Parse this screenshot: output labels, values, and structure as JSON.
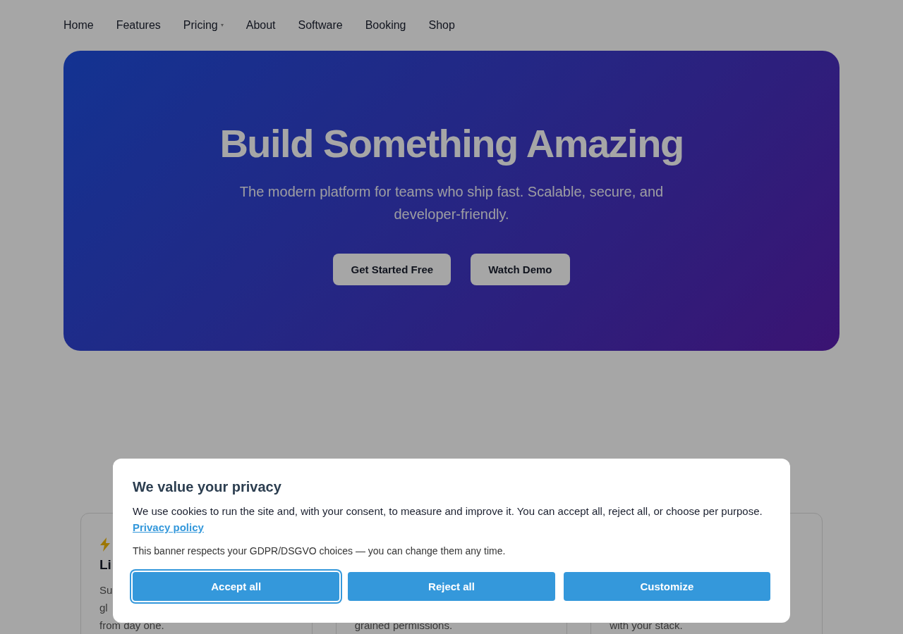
{
  "nav": [
    {
      "label": "Home",
      "has_dropdown": false
    },
    {
      "label": "Features",
      "has_dropdown": false
    },
    {
      "label": "Pricing",
      "has_dropdown": true
    },
    {
      "label": "About",
      "has_dropdown": false
    },
    {
      "label": "Software",
      "has_dropdown": false
    },
    {
      "label": "Booking",
      "has_dropdown": false
    },
    {
      "label": "Shop",
      "has_dropdown": false
    }
  ],
  "hero": {
    "title": "Build Something Amazing",
    "subtitle": "The modern platform for teams who ship fast. Scalable, secure, and developer-friendly.",
    "buttons": [
      "Get Started Free",
      "Watch Demo"
    ]
  },
  "cards": [
    {
      "icon": true,
      "title": "Li",
      "lines": [
        "Su",
        "gl",
        "from day one."
      ]
    },
    {
      "lines": [
        "grained permissions."
      ]
    },
    {
      "lines": [
        "with your stack."
      ]
    }
  ],
  "cookie_banner": {
    "title": "We value your privacy",
    "text": "We use cookies to run the site and, with your consent, to measure and improve it. You can accept all, reject all, or choose per purpose.",
    "link": "Privacy policy",
    "note": "This banner respects your GDPR/DSGVO choices — you can change them any time.",
    "buttons": [
      {
        "label": "Accept all",
        "focused": true
      },
      {
        "label": "Reject all",
        "focused": false
      },
      {
        "label": "Customize",
        "focused": false
      }
    ]
  }
}
